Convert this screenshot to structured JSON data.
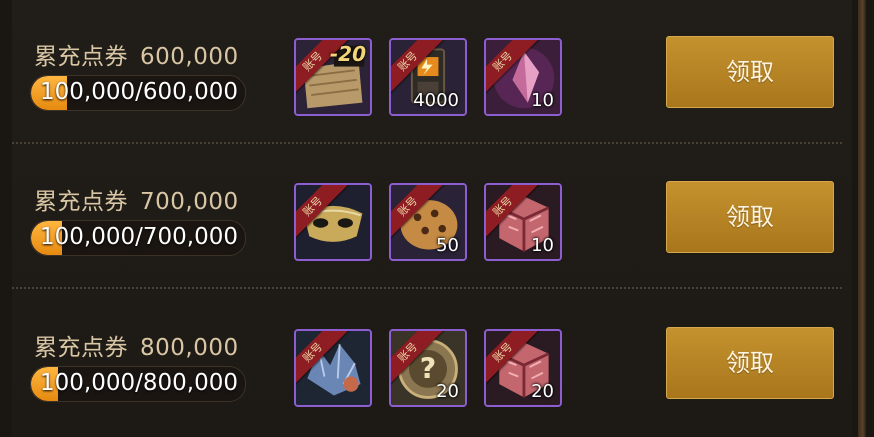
{
  "tiers": [
    {
      "label": "累充点券",
      "amount": "600,000",
      "progress_text": "100,000/600,000",
      "progress_fraction": 0.1667,
      "claim_label": "领取",
      "items": [
        {
          "ribbon": "账号",
          "icon": "level-ticket-icon",
          "badge": "-20",
          "qty": ""
        },
        {
          "ribbon": "账号",
          "icon": "battery-device-icon",
          "badge": "",
          "qty": "4000"
        },
        {
          "ribbon": "账号",
          "icon": "pink-crystal-icon",
          "badge": "",
          "qty": "10"
        }
      ]
    },
    {
      "label": "累充点券",
      "amount": "700,000",
      "progress_text": "100,000/700,000",
      "progress_fraction": 0.1429,
      "claim_label": "领取",
      "items": [
        {
          "ribbon": "账号",
          "icon": "gold-mask-icon",
          "badge": "",
          "qty": ""
        },
        {
          "ribbon": "账号",
          "icon": "cookie-icon",
          "badge": "",
          "qty": "50"
        },
        {
          "ribbon": "账号",
          "icon": "pink-cube-box-icon",
          "badge": "",
          "qty": "10"
        }
      ]
    },
    {
      "label": "累充点券",
      "amount": "800,000",
      "progress_text": "100,000/800,000",
      "progress_fraction": 0.125,
      "claim_label": "领取",
      "items": [
        {
          "ribbon": "账号",
          "icon": "crystal-creature-icon",
          "badge": "",
          "qty": ""
        },
        {
          "ribbon": "账号",
          "icon": "mystery-gear-box-icon",
          "badge": "",
          "qty": "20"
        },
        {
          "ribbon": "账号",
          "icon": "pink-cube-box-icon",
          "badge": "",
          "qty": "20"
        }
      ]
    }
  ]
}
